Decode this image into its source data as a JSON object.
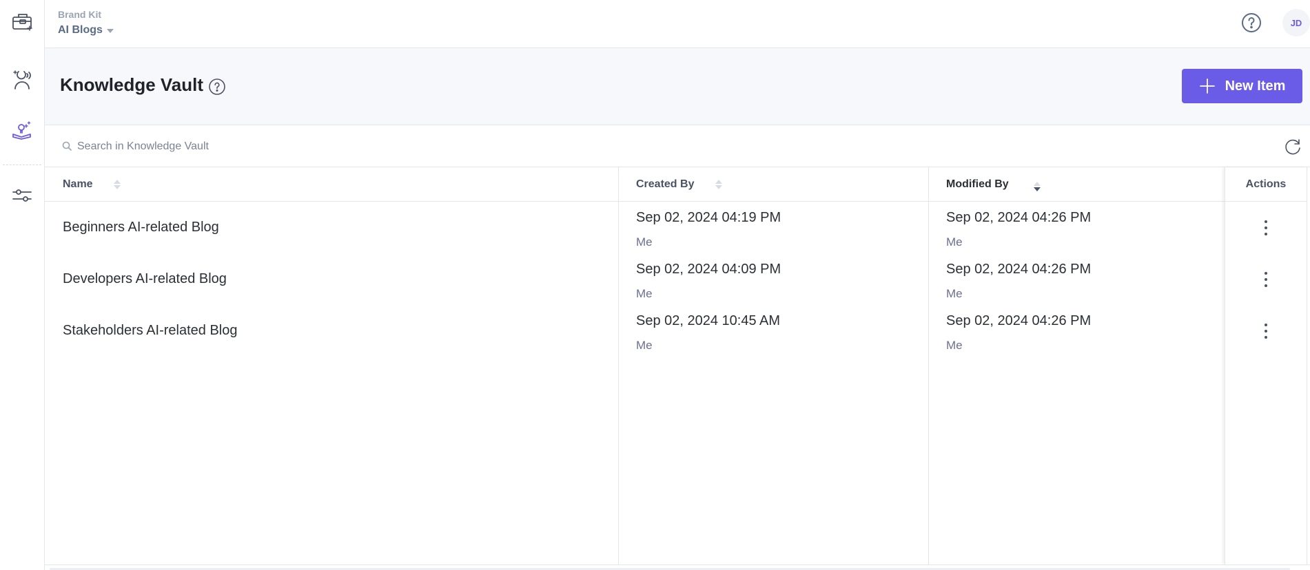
{
  "rail": {
    "items": [
      {
        "name": "brand-kit",
        "icon": "toolbox-sparkle-icon"
      },
      {
        "name": "persona",
        "icon": "persona-voice-icon"
      },
      {
        "name": "knowledge-vault",
        "icon": "book-lightbulb-sparkle-icon",
        "active": true
      },
      {
        "name": "settings",
        "icon": "sliders-icon"
      }
    ]
  },
  "header": {
    "brand_label": "Brand Kit",
    "brand_value": "AI Blogs",
    "help_icon": "question-circle-icon",
    "avatar_initials": "JD"
  },
  "page": {
    "title": "Knowledge Vault",
    "new_button_label": "New Item",
    "accent_color": "#6b5ce7"
  },
  "search": {
    "placeholder": "Search in Knowledge Vault",
    "value": ""
  },
  "table": {
    "columns": [
      {
        "label": "Name",
        "sortable": true
      },
      {
        "label": "Created By",
        "sortable": true
      },
      {
        "label": "Modified By",
        "sortable": true,
        "sorted": "desc"
      },
      {
        "label": "Actions",
        "sortable": false
      }
    ],
    "rows": [
      {
        "name": "Beginners AI-related Blog",
        "created_at": "Sep 02, 2024 04:19 PM",
        "created_by": "Me",
        "modified_at": "Sep 02, 2024 04:26 PM",
        "modified_by": "Me"
      },
      {
        "name": "Developers AI-related Blog",
        "created_at": "Sep 02, 2024 04:09 PM",
        "created_by": "Me",
        "modified_at": "Sep 02, 2024 04:26 PM",
        "modified_by": "Me"
      },
      {
        "name": "Stakeholders AI-related Blog",
        "created_at": "Sep 02, 2024 10:45 AM",
        "created_by": "Me",
        "modified_at": "Sep 02, 2024 04:26 PM",
        "modified_by": "Me"
      }
    ]
  }
}
